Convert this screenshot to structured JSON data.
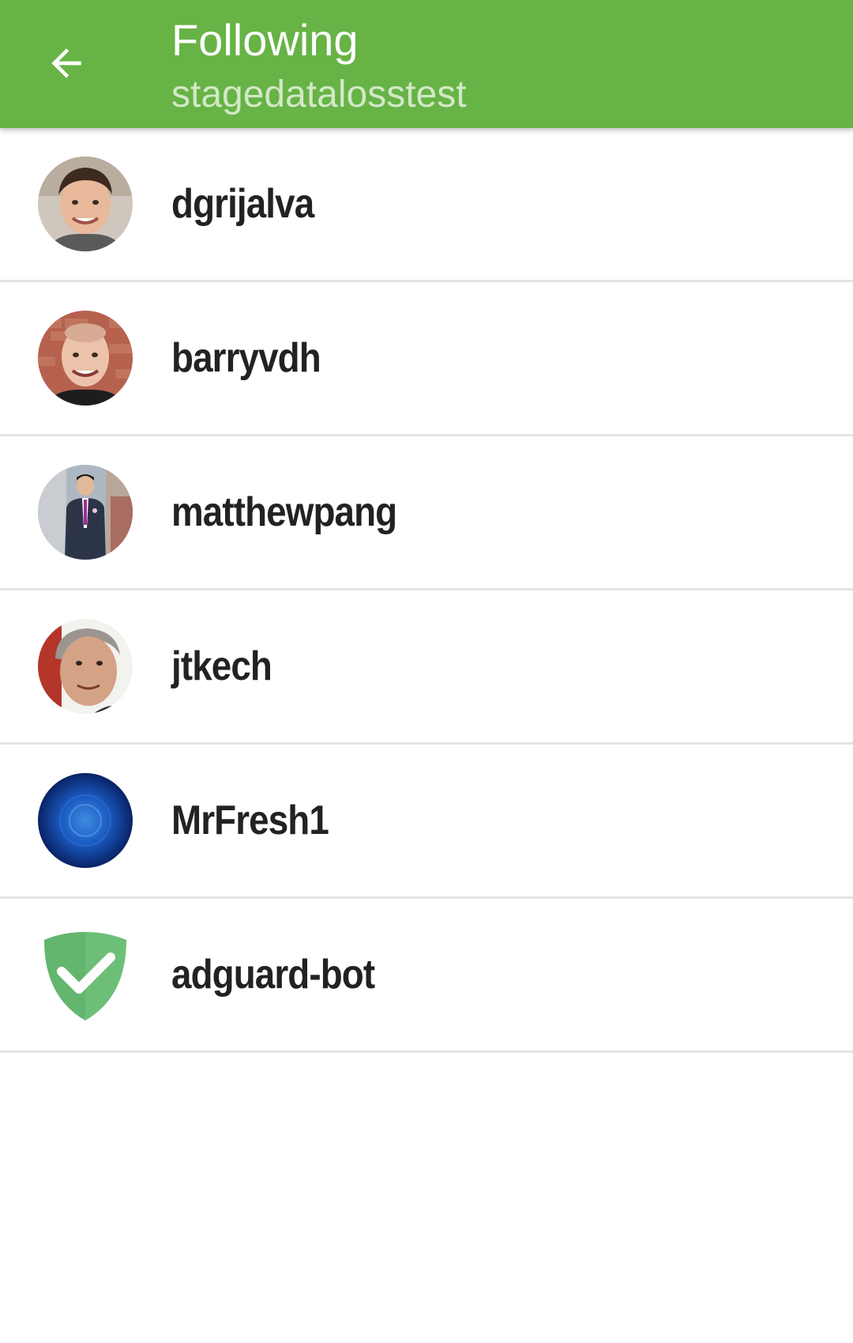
{
  "toolbar": {
    "title": "Following",
    "subtitle": "stagedatalosstest",
    "back_icon": "arrow-left-icon",
    "background_color": "#67b346"
  },
  "users": [
    {
      "username": "dgrijalva",
      "avatar_icon": "user-photo-avatar"
    },
    {
      "username": "barryvdh",
      "avatar_icon": "user-photo-avatar"
    },
    {
      "username": "matthewpang",
      "avatar_icon": "user-photo-avatar"
    },
    {
      "username": "jtkech",
      "avatar_icon": "user-photo-avatar"
    },
    {
      "username": "MrFresh1",
      "avatar_icon": "blue-orb-avatar"
    },
    {
      "username": "adguard-bot",
      "avatar_icon": "green-shield-check-icon"
    }
  ]
}
